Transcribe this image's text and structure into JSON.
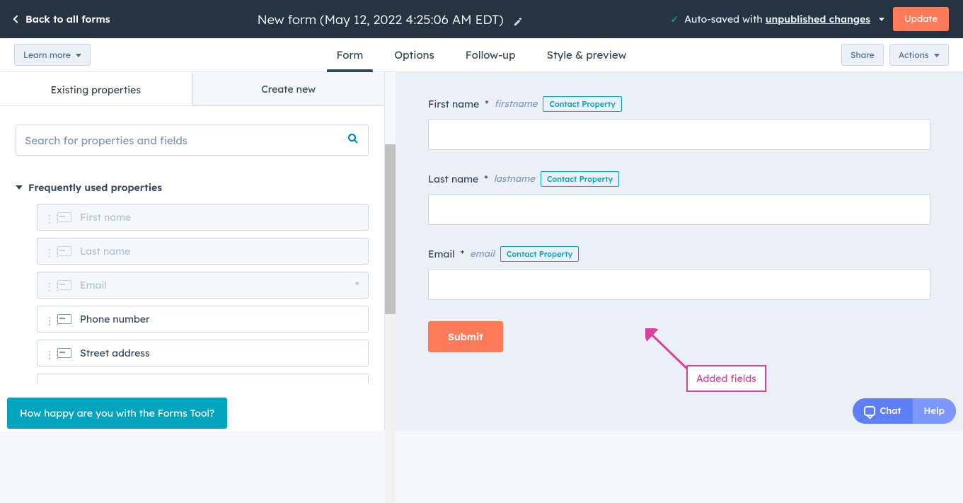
{
  "topbar": {
    "back_label": "Back to all forms",
    "title": "New form (May 12, 2022 4:25:06 AM EDT)",
    "autosave_prefix": "Auto-saved with ",
    "autosave_emph": "unpublished changes",
    "update_label": "Update"
  },
  "subbar": {
    "learn_label": "Learn more",
    "tabs": {
      "form": "Form",
      "options": "Options",
      "followup": "Follow-up",
      "style": "Style & preview"
    },
    "share_label": "Share",
    "actions_label": "Actions"
  },
  "left": {
    "tabs": {
      "existing": "Existing properties",
      "create": "Create new"
    },
    "search_placeholder": "Search for properties and fields",
    "section_title": "Frequently used properties",
    "items": [
      {
        "label": "First name",
        "disabled": true,
        "required": false
      },
      {
        "label": "Last name",
        "disabled": true,
        "required": false
      },
      {
        "label": "Email",
        "disabled": true,
        "required": true
      },
      {
        "label": "Phone number",
        "disabled": false,
        "required": false
      },
      {
        "label": "Street address",
        "disabled": false,
        "required": false
      }
    ]
  },
  "canvas": {
    "fields": [
      {
        "label": "First name",
        "req": "*",
        "api": "firstname",
        "badge": "Contact Property"
      },
      {
        "label": "Last name",
        "req": "*",
        "api": "lastname",
        "badge": "Contact Property"
      },
      {
        "label": "Email",
        "req": "*",
        "api": "email",
        "badge": "Contact Property"
      }
    ],
    "submit_label": "Submit"
  },
  "annotation": {
    "text": "Added fields"
  },
  "survey": {
    "text": "How happy are you with the Forms Tool?"
  },
  "chat": {
    "chat_label": "Chat",
    "help_label": "Help"
  }
}
